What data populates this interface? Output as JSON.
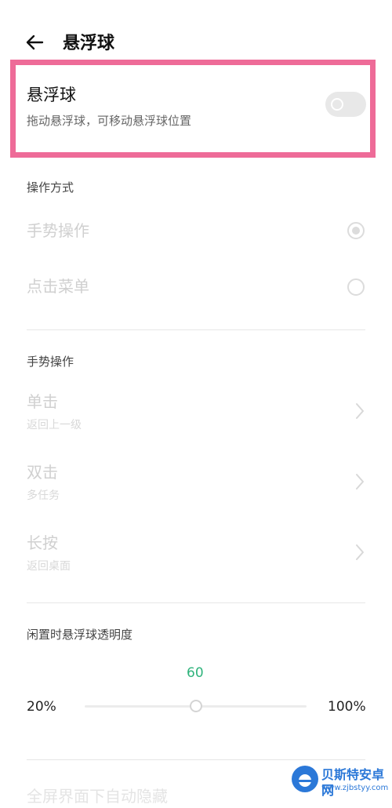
{
  "header": {
    "back_icon": "arrow-left-icon",
    "title": "悬浮球"
  },
  "floating_ball": {
    "title": "悬浮球",
    "subtitle": "拖动悬浮球，可移动悬浮球位置",
    "enabled": false
  },
  "operation_mode": {
    "heading": "操作方式",
    "options": [
      {
        "label": "手势操作",
        "selected": true
      },
      {
        "label": "点击菜单",
        "selected": false
      }
    ]
  },
  "gesture_ops": {
    "heading": "手势操作",
    "items": [
      {
        "label": "单击",
        "value": "返回上一级"
      },
      {
        "label": "双击",
        "value": "多任务"
      },
      {
        "label": "长按",
        "value": "返回桌面"
      }
    ]
  },
  "opacity": {
    "heading": "闲置时悬浮球透明度",
    "value": "60",
    "min_label": "20%",
    "max_label": "100%",
    "min": 20,
    "max": 100,
    "current": 60
  },
  "next_section_partial": "全屏界面下自动隐藏",
  "watermark": {
    "name": "贝斯特安卓网",
    "url": "www.zjbstyy.com"
  },
  "colors": {
    "highlight_border": "#ee6b98",
    "accent_green": "#2fb37c",
    "watermark_blue": "#2b78d8"
  }
}
